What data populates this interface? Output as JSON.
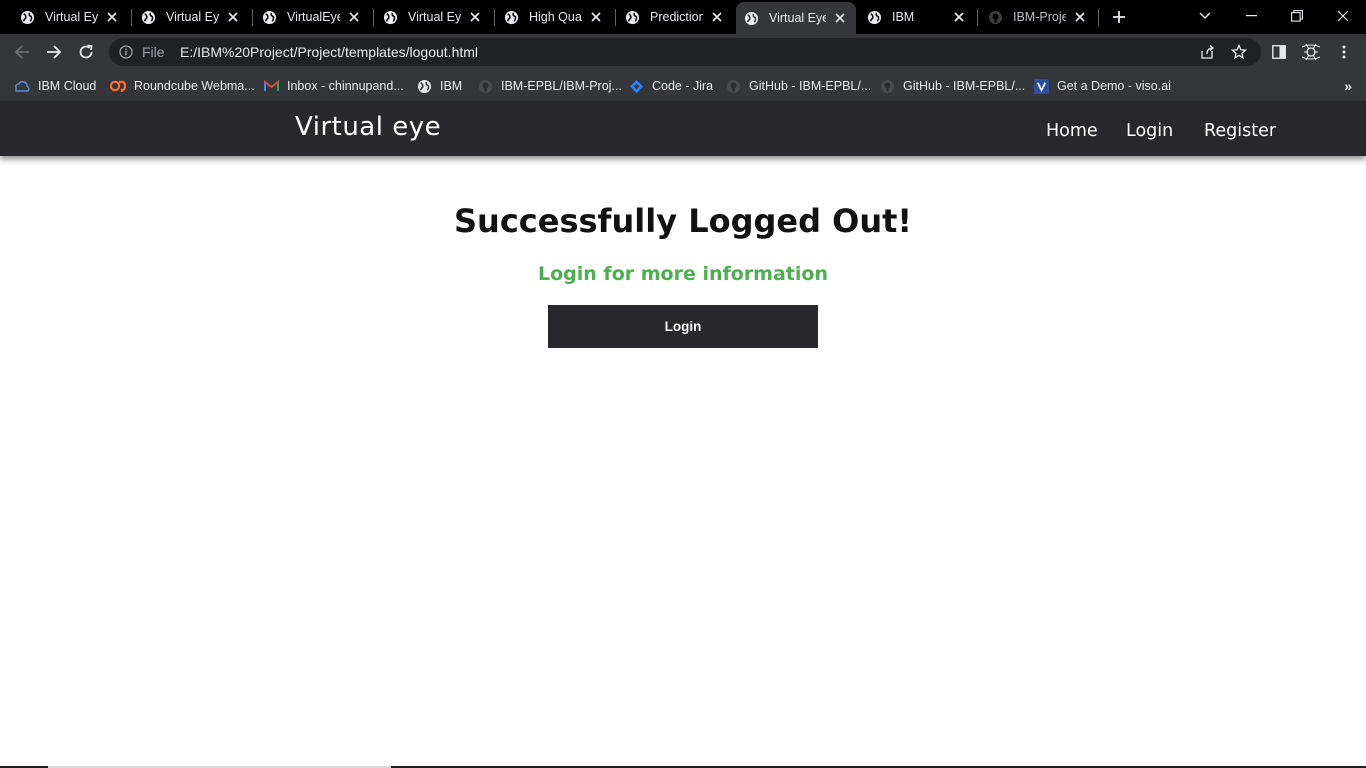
{
  "browser": {
    "tabs": [
      {
        "title": "Virtual Eye",
        "icon": "globe-icon",
        "active": false
      },
      {
        "title": "Virtual Eye",
        "icon": "globe-icon",
        "active": false
      },
      {
        "title": "VirtualEye",
        "icon": "globe-icon",
        "active": false
      },
      {
        "title": "Virtual Eye",
        "icon": "globe-icon",
        "active": false
      },
      {
        "title": "High Quali",
        "icon": "globe-icon",
        "active": false
      },
      {
        "title": "Prediction",
        "icon": "globe-icon",
        "active": false
      },
      {
        "title": "Virtual Eye",
        "icon": "globe-icon",
        "active": true
      },
      {
        "title": "IBM",
        "icon": "globe-icon",
        "active": false
      },
      {
        "title": "IBM-Projec",
        "icon": "github-icon",
        "active": false
      }
    ],
    "address": {
      "scheme_label": "File",
      "url": "E:/IBM%20Project/Project/templates/logout.html"
    },
    "bookmarks": [
      {
        "label": "IBM Cloud",
        "icon": "ibm-cloud-icon"
      },
      {
        "label": "Roundcube Webma...",
        "icon": "cpanel-icon"
      },
      {
        "label": "Inbox - chinnupand...",
        "icon": "gmail-icon"
      },
      {
        "label": "IBM",
        "icon": "globe-icon"
      },
      {
        "label": "IBM-EPBL/IBM-Proj...",
        "icon": "github-icon"
      },
      {
        "label": "Code - Jira",
        "icon": "jira-icon"
      },
      {
        "label": "GitHub - IBM-EPBL/...",
        "icon": "github-icon"
      },
      {
        "label": "GitHub - IBM-EPBL/...",
        "icon": "github-icon"
      },
      {
        "label": "Get a Demo - viso.ai",
        "icon": "viso-icon"
      }
    ],
    "bookmarks_overflow": "»"
  },
  "site": {
    "brand": "Virtual eye",
    "nav": [
      {
        "label": "Home"
      },
      {
        "label": "Login"
      },
      {
        "label": "Register"
      }
    ]
  },
  "page": {
    "heading": "Successfully Logged Out!",
    "subheading": "Login for more information",
    "button_label": "Login"
  },
  "colors": {
    "nav_background": "#28282d",
    "subheading_green": "#4caf50",
    "button_background": "#28282d",
    "browser_frame": "#35363a"
  }
}
